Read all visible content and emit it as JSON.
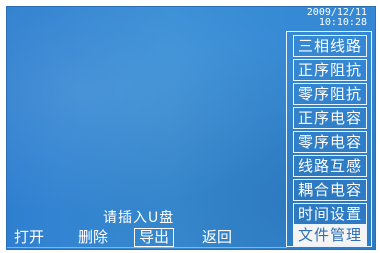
{
  "status": {
    "date": "2009/12/11",
    "time": "10:10:28"
  },
  "menu": {
    "items": [
      {
        "label": "三相线路"
      },
      {
        "label": "正序阻抗"
      },
      {
        "label": "零序阻抗"
      },
      {
        "label": "正序电容"
      },
      {
        "label": "零序电容"
      },
      {
        "label": "线路互感"
      },
      {
        "label": "耦合电容"
      },
      {
        "label": "时间设置"
      },
      {
        "label": "文件管理"
      }
    ],
    "selected": "文件管理"
  },
  "main": {
    "prompt": "请插入U盘"
  },
  "softkeys": [
    {
      "label": "打开"
    },
    {
      "label": "删除"
    },
    {
      "label": "导出"
    },
    {
      "label": "返回"
    }
  ],
  "colors": {
    "screen_bg": "#3a8fd6",
    "text": "#ffffff",
    "selected_bg": "#f4f4f4"
  }
}
